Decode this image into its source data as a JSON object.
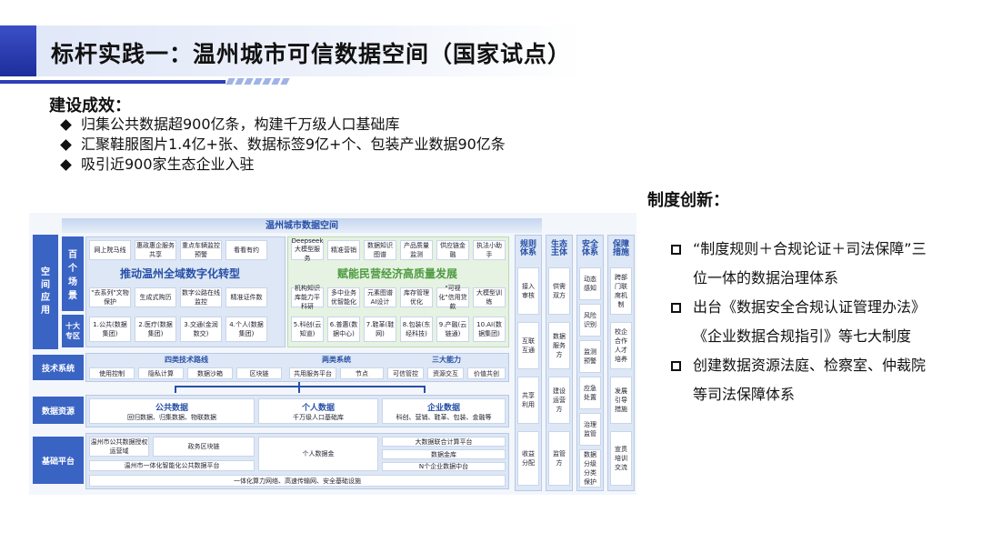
{
  "title": "标杆实践一：温州城市可信数据空间（国家试点）",
  "results": {
    "heading": "建设成效：",
    "items": [
      "归集公共数据超900亿条，构建千万级人口基础库",
      "汇聚鞋服图片1.4亿+张、数据标签9亿+个、包装产业数据90亿条",
      "吸引近900家生态企业入驻"
    ]
  },
  "diagram": {
    "title": "温州城市数据空间",
    "space_app": "空间应用",
    "scenes_label": "百个场景",
    "zhuanqu_label": "十大专区",
    "left_banner": "推动温州全域数字化转型",
    "right_banner": "赋能民营经济高质量发展",
    "left_row1": [
      "网上院马线",
      "惠政惠企服务共享",
      "重点车辆监控预警",
      "看看有约"
    ],
    "left_row2": [
      "\"去系列\"文物保护",
      "生成式购历",
      "数字公路在线监控",
      "精准证件数"
    ],
    "right_row1": [
      "Deepseek大模型服务",
      "精准营销",
      "数据知识图谱",
      "产品质量监测",
      "供应链金融",
      "执法小助手"
    ],
    "right_row2": [
      "机构知识库能力平科研",
      "多中业务优智能化",
      "元素图谱AI设计",
      "库存管理优化",
      "\"可视化\"信用贷款",
      "大模型训练"
    ],
    "left_zones": [
      "1.公共(数据集团)",
      "2.医疗(数据集团)",
      "3.交通(金润数交)",
      "4.个人(数据集团)"
    ],
    "right_zones": [
      "5.科创(云知道)",
      "6.普惠(数据中心)",
      "7.鞋革(鞋网)",
      "8.包装(东经科技)",
      "9.产融(云链通)",
      "10.AI(数据集团)"
    ],
    "tech_label": "技术系统",
    "tech_groups": [
      {
        "title": "四类技术路线",
        "items": [
          "使用控制",
          "隐私计算",
          "数据沙箱",
          "区块链"
        ]
      },
      {
        "title": "两类系统",
        "items": [
          "共用服务平台",
          "节点"
        ]
      },
      {
        "title": "三大能力",
        "items": [
          "可信管控",
          "资源交互",
          "价值共创"
        ]
      }
    ],
    "resource_label": "数据资源",
    "resources": [
      {
        "title": "公共数据",
        "desc": "回归数据、归集数据、物联数据"
      },
      {
        "title": "个人数据",
        "desc": "千万级人口基础库"
      },
      {
        "title": "企业数据",
        "desc": "科创、营销、鞋革、包装、金融等"
      }
    ],
    "platform_label": "基础平台",
    "platform_items": [
      "温州市公共数据授权运营域",
      "政务区块链",
      "温州市一体化智能化公共数据平台",
      "个人数据金",
      "大数据联合计算平台",
      "数据金库",
      "N个企业数据中台"
    ],
    "platform_bottom": "一体化算力网络、高速传输网、安全基础设施",
    "columns": [
      {
        "header": "规则体系",
        "cells": [
          "接入审核",
          "互联互通",
          "共享利用",
          "收益分配"
        ]
      },
      {
        "header": "生态主体",
        "cells": [
          "供需双方",
          "数据服务方",
          "建设运营方",
          "监管方"
        ]
      },
      {
        "header": "安全体系",
        "cells": [
          "动态感知",
          "风险识别",
          "监测预警",
          "应急处置",
          "治理监管",
          "数据分级分类保护"
        ]
      },
      {
        "header": "保障措施",
        "cells": [
          "跨部门联席机制",
          "校企合作人才培养",
          "发展引导措施",
          "宣贯培训交流"
        ]
      }
    ]
  },
  "system": {
    "heading": "制度创新：",
    "items": [
      "“制度规则＋合规论证＋司法保障”三位一体的数据治理体系",
      "出台《数据安全合规认证管理办法》《企业数据合规指引》等七大制度",
      "创建数据资源法庭、检察室、仲裁院等司法保障体系"
    ]
  },
  "colors": {
    "accent": "#2e3fb6",
    "diagram_blue": "#3a64c4",
    "diagram_green": "#4d9b40"
  }
}
